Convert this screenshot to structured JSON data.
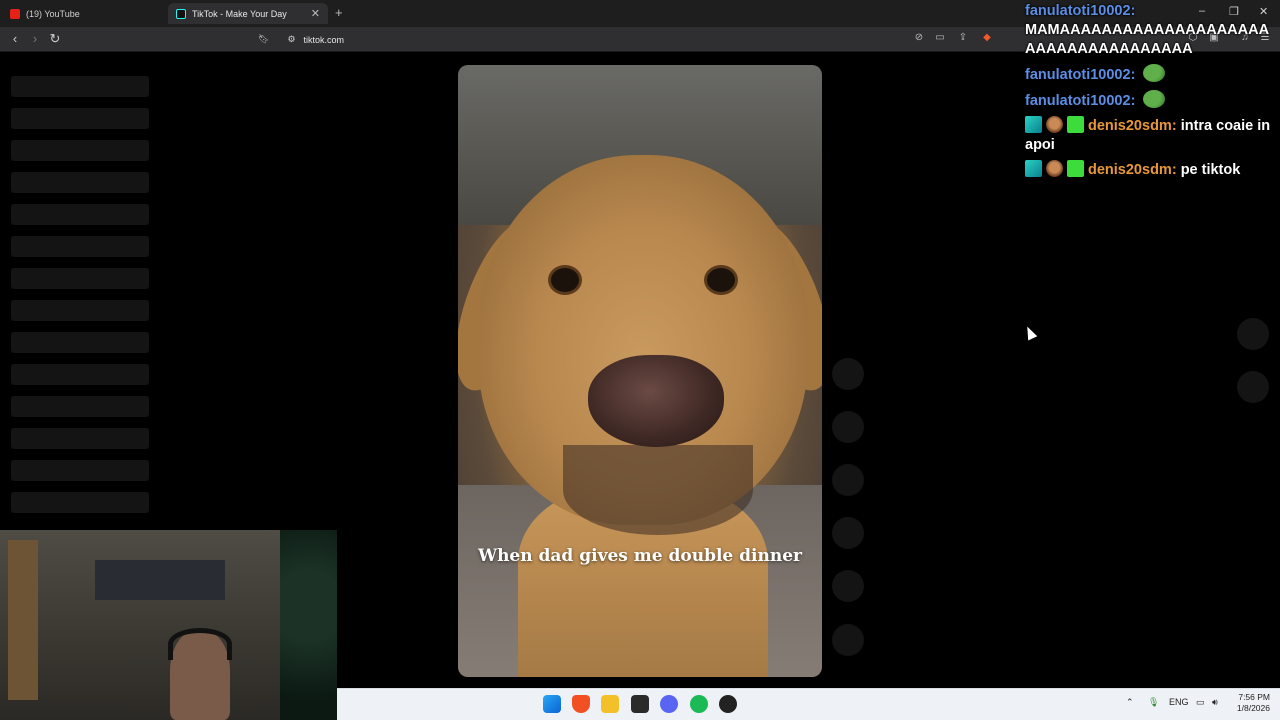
{
  "browser": {
    "tabs": [
      {
        "label": "(19) YouTube",
        "icon": "youtube-icon",
        "active": false
      },
      {
        "label": "TikTok - Make Your Day",
        "icon": "tiktok-icon",
        "active": true
      }
    ],
    "url": "tiktok.com"
  },
  "video": {
    "caption": "When dad gives me double dinner"
  },
  "chat": {
    "messages": [
      {
        "user": "fanulatoti10002:",
        "user_color": "#5b8fe6",
        "text": "MAMAAAAAAAAAAAAAAAAAAAAAAAAAAAAAAAAAAAA",
        "emote": false
      },
      {
        "user": "fanulatoti10002:",
        "user_color": "#5b8fe6",
        "text": "",
        "emote": true
      },
      {
        "user": "fanulatoti10002:",
        "user_color": "#5b8fe6",
        "text": "",
        "emote": true
      },
      {
        "user": "denis20sdm:",
        "user_color": "#e8973a",
        "text": "intra coaie inapoi",
        "badges": true
      },
      {
        "user": "denis20sdm:",
        "user_color": "#e8973a",
        "text": "pe tiktok",
        "badges": true
      }
    ]
  },
  "taskbar": {
    "language": "ENG",
    "time": "7:56 PM",
    "date": "1/8/2026"
  }
}
